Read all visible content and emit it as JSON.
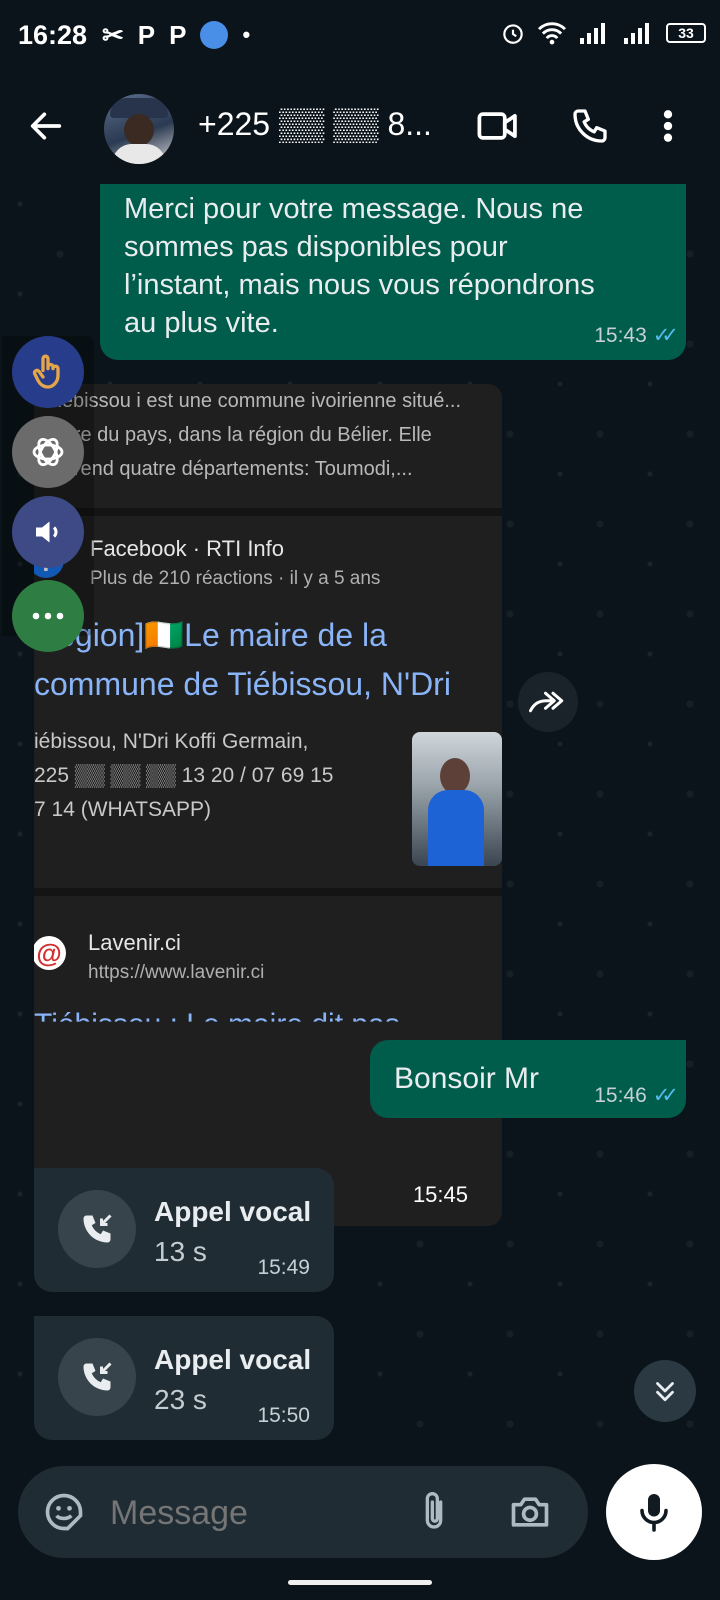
{
  "status_bar": {
    "time": "16:28",
    "left_glyphs": [
      "✂",
      "P",
      "P",
      "•"
    ],
    "battery": "33"
  },
  "header": {
    "contact_name": "+225 ▒▒ ▒▒ 8..."
  },
  "messages": {
    "auto_reply": {
      "text": "Merci pour votre message. Nous ne sommes pas disponibles pour l’instant, mais nous vous répondrons au plus vite.",
      "time": "15:43"
    },
    "shared_screenshot": {
      "snippet": "Tiébissou i est une commune ivoirienne situé... entre du pays, dans la région du Bélier. Elle ...prend quatre départements: Toumodi,...",
      "source1_name": "Facebook · RTI Info",
      "source1_meta": "Plus de 210 réactions · il y a 5 ans",
      "headline_line1": "Région]🇨🇮Le maire de la",
      "headline_line2": "commune de Tiébissou, N'Dri",
      "body_line1": "iébissou, N'Dri Koffi Germain,",
      "body_line2": "225 ▒▒ ▒▒ ▒▒ 13 20 / 07 69 15",
      "body_line3": "7 14 (WHATSAPP)",
      "source2_name": "Lavenir.ci",
      "source2_url": "https://www.lavenir.ci",
      "cut_text": "Tiébissou : Le maire dit pas",
      "time": "15:45"
    },
    "greeting": {
      "text": "Bonsoir Mr",
      "time": "15:46"
    },
    "call1": {
      "title": "Appel vocal",
      "duration": "13 s",
      "time": "15:49"
    },
    "call2": {
      "title": "Appel vocal",
      "duration": "23 s",
      "time": "15:50"
    }
  },
  "composer": {
    "placeholder": "Message"
  },
  "colors": {
    "background": "#0b141a",
    "outgoing_bubble": "#005c4b",
    "incoming_bubble": "#202c33",
    "read_ticks": "#53bdeb"
  }
}
